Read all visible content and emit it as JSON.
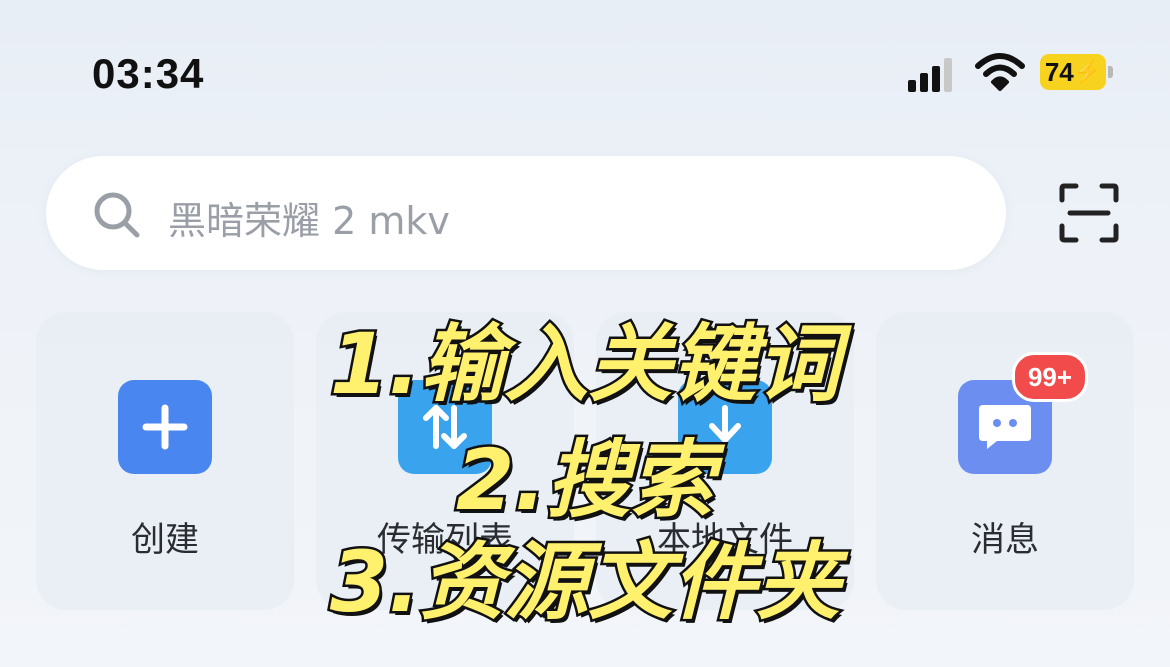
{
  "status_bar": {
    "time": "03:34",
    "battery": "74",
    "battery_color": "#f7d21e",
    "icons": [
      "cellular-signal-icon",
      "wifi-icon",
      "battery-charging-icon"
    ]
  },
  "search": {
    "placeholder": "黑暗荣耀 2 mkv",
    "icon": "search-icon",
    "scan_icon": "scan-icon"
  },
  "shortcuts": [
    {
      "label": "创建",
      "icon": "plus-icon",
      "color": "#4a86f0"
    },
    {
      "label": "传输列表",
      "icon": "transfer-icon",
      "color": "#3aa3ee"
    },
    {
      "label": "本地文件",
      "icon": "download-folder-icon",
      "color": "#3aa3ee"
    },
    {
      "label": "消息",
      "icon": "message-icon",
      "color": "#6b8ef0",
      "badge": "99+"
    }
  ],
  "overlay_text": {
    "line1": "1.输入关键词",
    "line2": "2.搜索",
    "line3": "3.资源文件夹",
    "color": "#fff06e"
  }
}
